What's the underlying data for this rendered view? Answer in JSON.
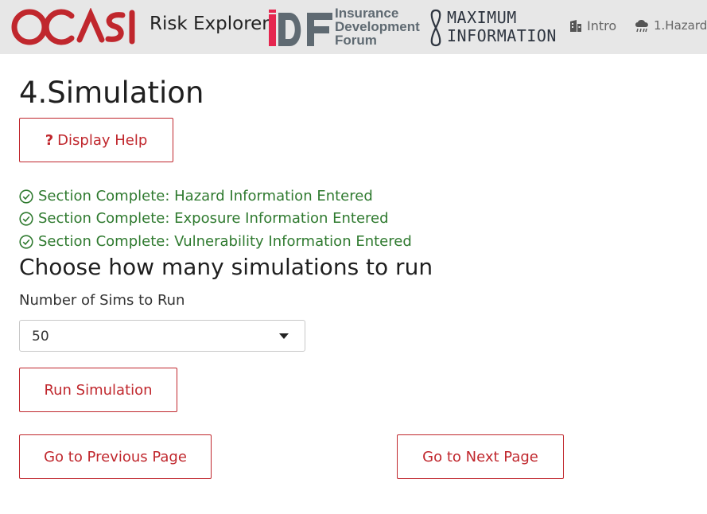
{
  "header": {
    "brand_logo": "OASIS",
    "app_title": "Risk Explorer",
    "idf_logo": {
      "monogram": "iDF",
      "lines": [
        "Insurance",
        "Development",
        "Forum"
      ]
    },
    "maxinfo_logo": {
      "lines": [
        "MAXIMUM",
        "INFORMATION"
      ]
    },
    "nav": [
      {
        "label": "Intro",
        "icon": "building-icon"
      },
      {
        "label": "1.Hazard",
        "icon": "storm-cloud-icon"
      }
    ],
    "colors": {
      "bar_bg": "#e7e7e7",
      "oasis_red": "#c0272d",
      "idf_pink": "#e5264f"
    }
  },
  "page": {
    "title": "4.Simulation",
    "help_button": {
      "icon": "question-icon",
      "label": "Display Help"
    },
    "status_messages": [
      "Section Complete: Hazard Information Entered",
      "Section Complete: Exposure Information Entered",
      "Section Complete: Vulnerability Information Entered"
    ],
    "section_heading": "Choose how many simulations to run",
    "sims_field": {
      "label": "Number of Sims to Run",
      "selected_value": "50"
    },
    "run_button": "Run Simulation",
    "prev_button": "Go to Previous Page",
    "next_button": "Go to Next Page",
    "colors": {
      "accent": "#c0272d",
      "success": "#2f7a2f"
    }
  }
}
